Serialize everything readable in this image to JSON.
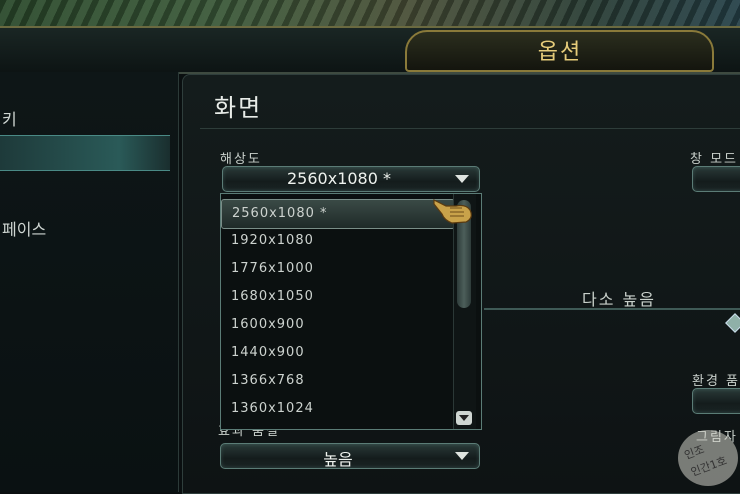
{
  "window": {
    "title": "옵션"
  },
  "sidebar": {
    "items": [
      {
        "label": "키"
      },
      {
        "label": ""
      },
      {
        "label": "페이스"
      }
    ]
  },
  "main": {
    "section_title": "화면",
    "resolution": {
      "label": "해상도",
      "selected": "2560x1080 *",
      "options": [
        "2560x1080 *",
        "1920x1080",
        "1776x1000",
        "1680x1050",
        "1600x900",
        "1440x900",
        "1366x768",
        "1360x1024"
      ]
    },
    "window_mode": {
      "label": "창 모드"
    },
    "quality_text": "다소 높음",
    "environment_label": "환경 품",
    "effects": {
      "label": "효과 품질",
      "value": "높음"
    },
    "extra_label": "그림자"
  },
  "watermark": {
    "line1": "인조",
    "line2": "인간1호"
  },
  "colors": {
    "accent_gold": "#e6cc7a",
    "border_teal": "#5b7c76"
  }
}
